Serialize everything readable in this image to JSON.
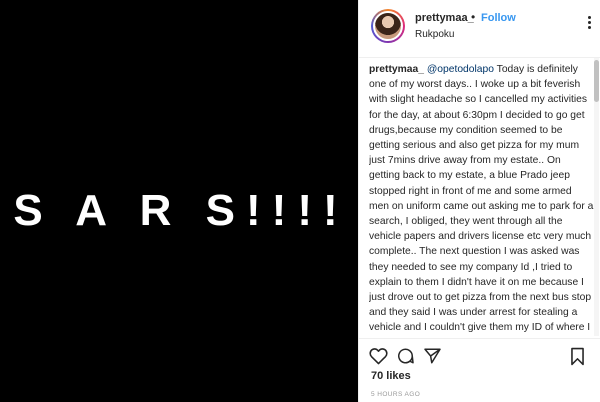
{
  "media": {
    "text": "S A R S!!!!"
  },
  "header": {
    "username": "prettymaa_",
    "separator": "•",
    "follow_label": "Follow",
    "location": "Rukpoku"
  },
  "caption": {
    "username": "prettymaa_",
    "mention": "@opetodolapo",
    "text": "Today is definitely one of my worst days.. I woke up a bit feverish with slight headache so I cancelled my activities for the day, at about 6:30pm I decided to go get drugs,because my condition seemed to be getting serious and also get pizza for my mum just 7mins drive away from my estate.. On getting back to my estate, a blue Prado jeep stopped right in front of me and some armed men on uniform came out asking me to park for a search, I obliged, they went through all the vehicle papers and drivers license etc very much complete.. The next question I was asked was they needed to see my company Id ,I tried to explain to them I didn't have it on me because I just drove out to get pizza from the next bus stop and they said I was under arrest for stealing a vehicle and I couldn't give them my ID of where I work. I told them I work"
  },
  "stats": {
    "likes": "70 likes",
    "time": "5 HOURS AGO"
  },
  "icons": {
    "like": "heart-icon",
    "comment": "comment-icon",
    "share": "share-icon",
    "save": "bookmark-icon",
    "more": "more-options-icon"
  },
  "colors": {
    "accent": "#3897f0",
    "media_bg": "#000000"
  }
}
